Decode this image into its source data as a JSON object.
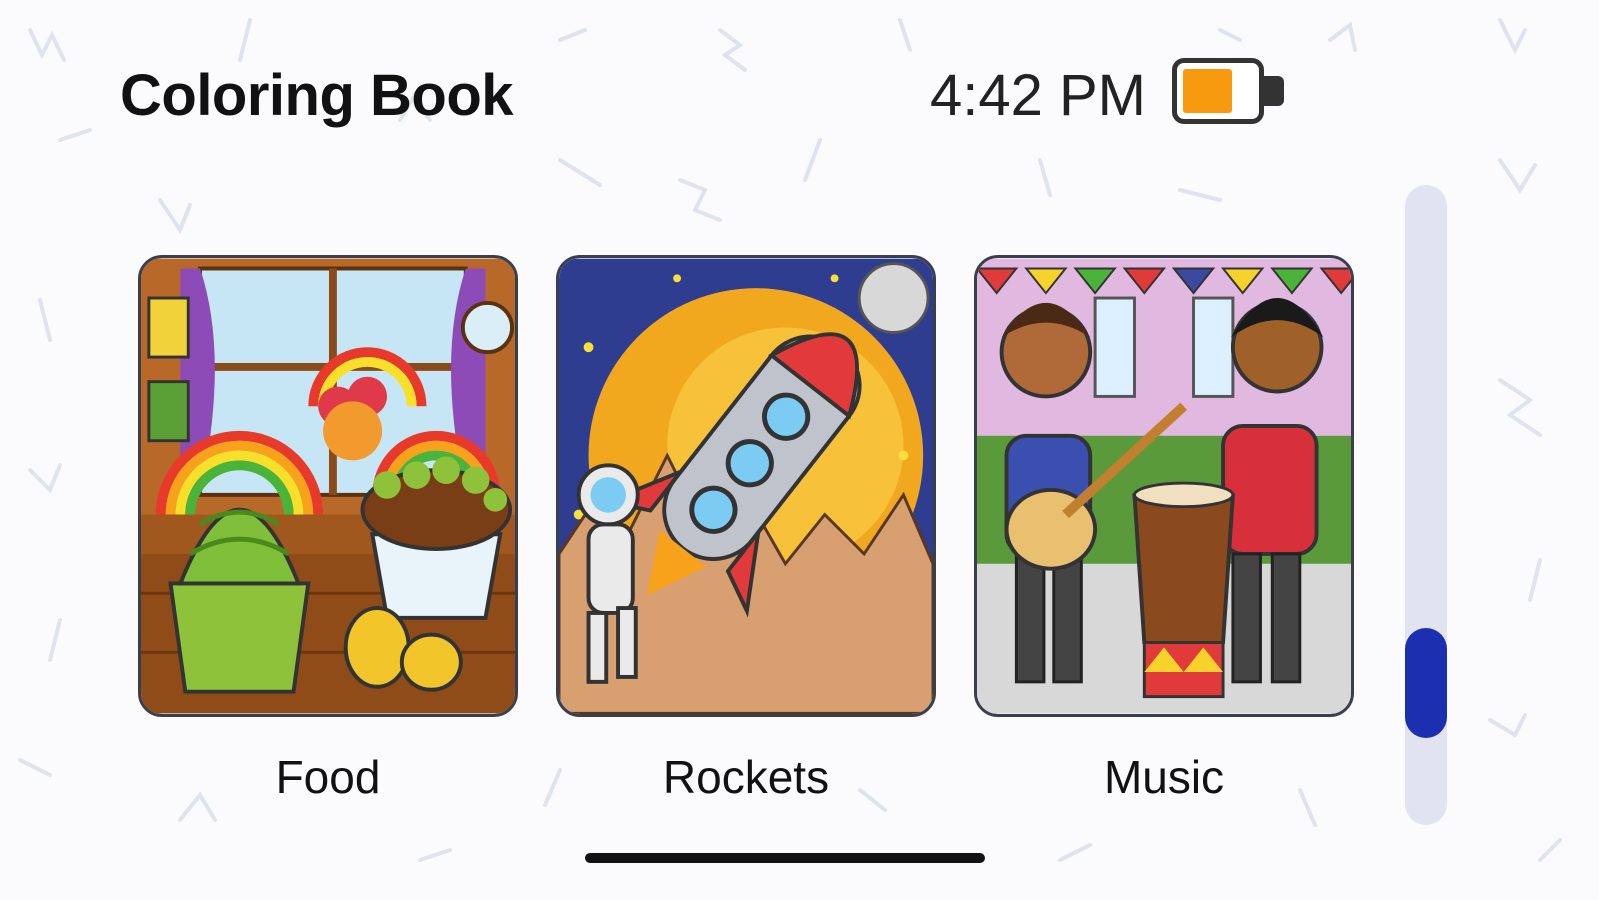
{
  "header": {
    "title": "Coloring Book",
    "time": "4:42 PM",
    "battery": {
      "level": 0.7,
      "fill_color": "#F79A10"
    }
  },
  "categories": [
    {
      "label": "Food",
      "icon": "cupcakes-illustration"
    },
    {
      "label": "Rockets",
      "icon": "rocket-astronaut-illustration"
    },
    {
      "label": "Music",
      "icon": "musicians-illustration"
    }
  ],
  "scrollbar": {
    "position": 0.88,
    "thumb_color": "#1C2FB0"
  },
  "colors": {
    "background": "#FBFBFE",
    "card_border": "#3A3F4D"
  }
}
